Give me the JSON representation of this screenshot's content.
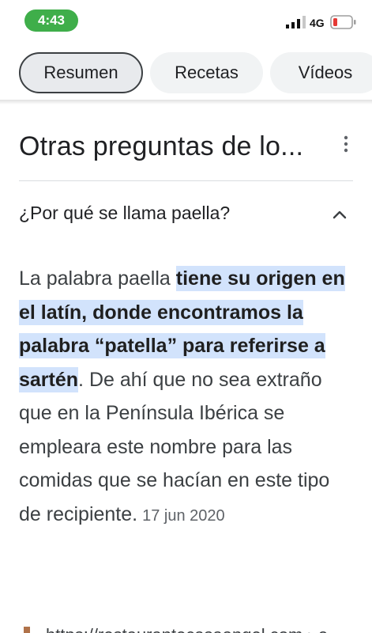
{
  "status_bar": {
    "time": "4:43",
    "network": "4G",
    "icons": [
      "signal-icon",
      "battery-icon"
    ],
    "colors": {
      "time_pill": "#3fae4a",
      "battery_low": "#e53935"
    }
  },
  "tabs": [
    {
      "label": "Resumen",
      "active": true
    },
    {
      "label": "Recetas",
      "active": false
    },
    {
      "label": "Vídeos",
      "active": false
    }
  ],
  "section": {
    "title": "Otras preguntas de lo...",
    "more_icon": "more-vert-icon"
  },
  "question": {
    "text": "¿Por qué se llama paella?",
    "toggle_icon": "chevron-up-icon"
  },
  "answer": {
    "lead": "La palabra paella ",
    "highlight": "tiene su origen en el latín, donde encontramos la palabra “patella” para referirse a sartén",
    "rest": ". De ahí que no sea extraño que en la Península Ibérica se empleara este nombre para las comidas que se hacían en este tipo de recipiente.",
    "date": "17 jun 2020",
    "highlight_color": "#d2e3fc"
  },
  "source": {
    "url": "https://restaurantecasaangel.com › e..."
  }
}
